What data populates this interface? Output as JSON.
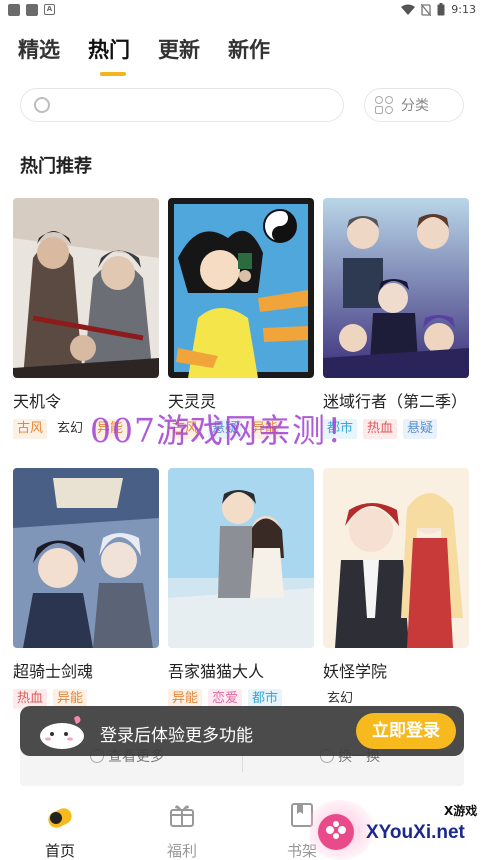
{
  "status_bar": {
    "time": "9:13"
  },
  "tabs": [
    {
      "label": "精选",
      "active": false
    },
    {
      "label": "热门",
      "active": true
    },
    {
      "label": "更新",
      "active": false
    },
    {
      "label": "新作",
      "active": false
    }
  ],
  "search": {
    "placeholder": "",
    "category_label": "分类"
  },
  "section": {
    "title": "热门推荐"
  },
  "comics": [
    {
      "title": "天机令",
      "tags": [
        {
          "text": "古风",
          "color": "#e8863a",
          "bg": "#fdf0e4"
        },
        {
          "text": "玄幻",
          "color": "#333333",
          "bg": "#ffffff"
        },
        {
          "text": "异能",
          "color": "#e8863a",
          "bg": "#fdf0e4"
        }
      ]
    },
    {
      "title": "天灵灵",
      "tags": [
        {
          "text": "古风",
          "color": "#e8863a",
          "bg": "#fdf0e4"
        },
        {
          "text": "悬疑",
          "color": "#5b8fd0",
          "bg": "#e9f1fb"
        },
        {
          "text": "异能",
          "color": "#e8863a",
          "bg": "#fdf0e4"
        }
      ]
    },
    {
      "title": "迷域行者（第二季）",
      "tags": [
        {
          "text": "都市",
          "color": "#3aa7d9",
          "bg": "#e6f5fb"
        },
        {
          "text": "热血",
          "color": "#e05a5a",
          "bg": "#fdeaea"
        },
        {
          "text": "悬疑",
          "color": "#5b8fd0",
          "bg": "#e9f1fb"
        }
      ]
    },
    {
      "title": "超骑士剑魂",
      "tags": [
        {
          "text": "热血",
          "color": "#e05a5a",
          "bg": "#fdeaea"
        },
        {
          "text": "异能",
          "color": "#e8863a",
          "bg": "#fdf0e4"
        }
      ]
    },
    {
      "title": "吾家猫猫大人",
      "tags": [
        {
          "text": "异能",
          "color": "#e8863a",
          "bg": "#fdf0e4"
        },
        {
          "text": "恋爱",
          "color": "#e86aa0",
          "bg": "#fdeaf3"
        },
        {
          "text": "都市",
          "color": "#3aa7d9",
          "bg": "#e6f5fb"
        }
      ]
    },
    {
      "title": "妖怪学院",
      "tags": [
        {
          "text": "玄幻",
          "color": "#333333",
          "bg": "#ffffff"
        }
      ]
    }
  ],
  "more": {
    "view_more": "查看更多",
    "refresh": "换一换"
  },
  "toast": {
    "text": "登录后体验更多功能",
    "button": "立即登录"
  },
  "nav": [
    {
      "label": "首页",
      "icon": "home-icon",
      "active": true
    },
    {
      "label": "福利",
      "icon": "gift-icon",
      "active": false
    },
    {
      "label": "书架",
      "icon": "bookshelf-icon",
      "active": false
    }
  ],
  "watermark": "007游戏网亲测！",
  "corner_logo": {
    "top": "X游戏",
    "bottom": "XYouXi.net"
  },
  "colors": {
    "accent": "#f2b51b",
    "toast_bg": "#3c3c3c"
  }
}
